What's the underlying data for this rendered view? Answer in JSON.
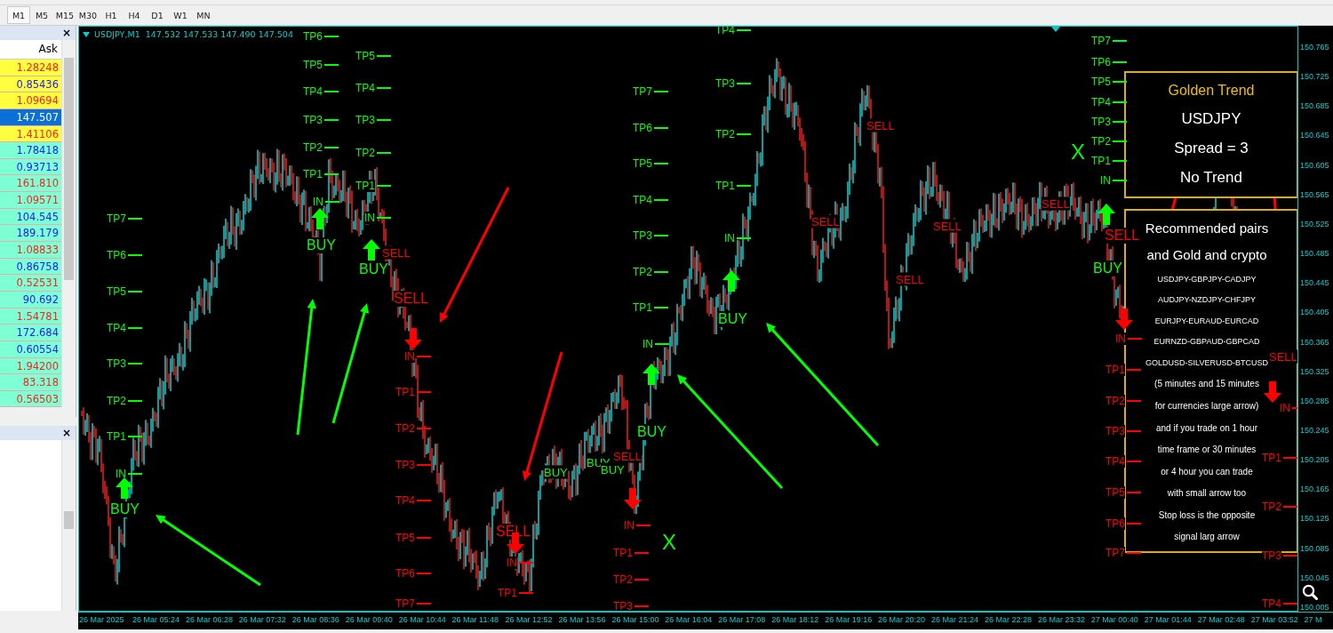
{
  "toolbar": {
    "timeframes": [
      {
        "label": "M1",
        "selected": true
      },
      {
        "label": "M5",
        "selected": false
      },
      {
        "label": "M15",
        "selected": false
      },
      {
        "label": "M30",
        "selected": false
      },
      {
        "label": "H1",
        "selected": false
      },
      {
        "label": "H4",
        "selected": false
      },
      {
        "label": "D1",
        "selected": false
      },
      {
        "label": "W1",
        "selected": false
      },
      {
        "label": "MN",
        "selected": false
      }
    ]
  },
  "market_watch": {
    "close": "×",
    "column": "Ask",
    "rows": [
      {
        "ask": "1.28248",
        "highlighted": true,
        "rising": false,
        "selected": false
      },
      {
        "ask": "0.85436",
        "highlighted": true,
        "rising": true,
        "selected": false
      },
      {
        "ask": "1.09694",
        "highlighted": true,
        "rising": false,
        "selected": false
      },
      {
        "ask": "147.507",
        "highlighted": false,
        "rising": true,
        "selected": true
      },
      {
        "ask": "1.41106",
        "highlighted": true,
        "rising": false,
        "selected": false
      },
      {
        "ask": "1.78418",
        "highlighted": false,
        "rising": true,
        "selected": false
      },
      {
        "ask": "0.93713",
        "highlighted": false,
        "rising": true,
        "selected": false
      },
      {
        "ask": "161.810",
        "highlighted": false,
        "rising": false,
        "selected": false
      },
      {
        "ask": "1.09571",
        "highlighted": false,
        "rising": false,
        "selected": false
      },
      {
        "ask": "104.545",
        "highlighted": false,
        "rising": true,
        "selected": false
      },
      {
        "ask": "189.179",
        "highlighted": false,
        "rising": true,
        "selected": false
      },
      {
        "ask": "1.08833",
        "highlighted": false,
        "rising": false,
        "selected": false
      },
      {
        "ask": "0.86758",
        "highlighted": false,
        "rising": true,
        "selected": false
      },
      {
        "ask": "0.52531",
        "highlighted": false,
        "rising": false,
        "selected": false
      },
      {
        "ask": "90.692",
        "highlighted": false,
        "rising": true,
        "selected": false
      },
      {
        "ask": "1.54781",
        "highlighted": false,
        "rising": false,
        "selected": false
      },
      {
        "ask": "172.684",
        "highlighted": false,
        "rising": true,
        "selected": false
      },
      {
        "ask": "0.60554",
        "highlighted": false,
        "rising": true,
        "selected": false
      },
      {
        "ask": "1.94200",
        "highlighted": false,
        "rising": false,
        "selected": false
      },
      {
        "ask": "83.318",
        "highlighted": false,
        "rising": false,
        "selected": false
      },
      {
        "ask": "0.56503",
        "highlighted": false,
        "rising": false,
        "selected": false
      }
    ]
  },
  "navigator": {
    "close": "×"
  },
  "chart": {
    "header": "USDJPY,M1  147.532 147.533 147.490 147.504",
    "price_axis": [
      "150.765",
      "150.725",
      "150.685",
      "150.645",
      "150.605",
      "150.565",
      "150.525",
      "150.485",
      "150.445",
      "150.405",
      "150.365",
      "150.325",
      "150.285",
      "150.245",
      "150.205",
      "150.165",
      "150.125",
      "150.085",
      "150.045",
      "150.005"
    ],
    "time_axis": [
      "26 Mar 2025",
      "26 Mar 05:24",
      "26 Mar 06:28",
      "26 Mar 07:32",
      "26 Mar 08:36",
      "26 Mar 09:40",
      "26 Mar 10:44",
      "26 Mar 11:48",
      "26 Mar 12:52",
      "26 Mar 13:56",
      "26 Mar 15:00",
      "26 Mar 16:04",
      "26 Mar 17:08",
      "26 Mar 18:12",
      "26 Mar 19:16",
      "26 Mar 20:20",
      "26 Mar 21:24",
      "26 Mar 22:28",
      "26 Mar 23:32",
      "27 Mar 00:40",
      "27 Mar 01:44",
      "27 Mar 02:48",
      "27 Mar 03:52",
      "27 M"
    ],
    "markers": [
      {
        "kind": "level",
        "buy": true,
        "text": "TP7"
      },
      {
        "kind": "level",
        "buy": true,
        "text": "TP6"
      },
      {
        "kind": "level",
        "buy": true,
        "text": "TP5"
      },
      {
        "kind": "level",
        "buy": true,
        "text": "TP4"
      },
      {
        "kind": "level",
        "buy": true,
        "text": "TP3"
      },
      {
        "kind": "level",
        "buy": true,
        "text": "TP2"
      },
      {
        "kind": "level",
        "buy": true,
        "text": "TP1"
      },
      {
        "kind": "level",
        "buy": true,
        "text": "IN"
      },
      {
        "kind": "signal",
        "buy": true,
        "text": "BUY"
      },
      {
        "kind": "arrow",
        "buy": true
      },
      {
        "kind": "level",
        "buy": true,
        "text": "TP6"
      },
      {
        "kind": "level",
        "buy": true,
        "text": "TP5"
      },
      {
        "kind": "level",
        "buy": true,
        "text": "TP4"
      },
      {
        "kind": "level",
        "buy": true,
        "text": "TP3"
      },
      {
        "kind": "level",
        "buy": true,
        "text": "TP2"
      },
      {
        "kind": "level",
        "buy": true,
        "text": "TP1"
      },
      {
        "kind": "level",
        "buy": true,
        "text": "IN"
      },
      {
        "kind": "signal",
        "buy": true,
        "text": "BUY"
      },
      {
        "kind": "arrow",
        "buy": true
      },
      {
        "kind": "level",
        "buy": true,
        "text": "TP5"
      },
      {
        "kind": "level",
        "buy": true,
        "text": "TP4"
      },
      {
        "kind": "level",
        "buy": true,
        "text": "TP3"
      },
      {
        "kind": "level",
        "buy": true,
        "text": "TP2"
      },
      {
        "kind": "level",
        "buy": true,
        "text": "TP1"
      },
      {
        "kind": "level",
        "buy": true,
        "text": "IN"
      },
      {
        "kind": "signal",
        "buy": true,
        "text": "BUY"
      },
      {
        "kind": "arrow",
        "buy": true
      },
      {
        "kind": "small",
        "buy": false,
        "text": "SELL"
      },
      {
        "kind": "signal",
        "buy": false,
        "text": "SELL"
      },
      {
        "kind": "arrow",
        "buy": false
      },
      {
        "kind": "level",
        "buy": false,
        "text": "IN"
      },
      {
        "kind": "level",
        "buy": false,
        "text": "TP1"
      },
      {
        "kind": "level",
        "buy": false,
        "text": "TP2"
      },
      {
        "kind": "level",
        "buy": false,
        "text": "TP3"
      },
      {
        "kind": "level",
        "buy": false,
        "text": "TP4"
      },
      {
        "kind": "level",
        "buy": false,
        "text": "TP5"
      },
      {
        "kind": "level",
        "buy": false,
        "text": "TP6"
      },
      {
        "kind": "level",
        "buy": false,
        "text": "TP7"
      },
      {
        "kind": "signal",
        "buy": false,
        "text": "SELL"
      },
      {
        "kind": "arrow",
        "buy": false
      },
      {
        "kind": "level",
        "buy": false,
        "text": "IN"
      },
      {
        "kind": "level",
        "buy": false,
        "text": "TP1"
      },
      {
        "kind": "small",
        "buy": true,
        "text": "BUY"
      },
      {
        "kind": "small",
        "buy": true,
        "text": "BUY"
      },
      {
        "kind": "small",
        "buy": true,
        "text": "BUY"
      },
      {
        "kind": "small",
        "buy": false,
        "text": "SELL"
      },
      {
        "kind": "level",
        "buy": true,
        "text": "TP7"
      },
      {
        "kind": "level",
        "buy": true,
        "text": "TP6"
      },
      {
        "kind": "level",
        "buy": true,
        "text": "TP5"
      },
      {
        "kind": "level",
        "buy": true,
        "text": "TP4"
      },
      {
        "kind": "level",
        "buy": true,
        "text": "TP3"
      },
      {
        "kind": "level",
        "buy": true,
        "text": "TP2"
      },
      {
        "kind": "level",
        "buy": true,
        "text": "TP1"
      },
      {
        "kind": "level",
        "buy": true,
        "text": "IN"
      },
      {
        "kind": "signal",
        "buy": true,
        "text": "BUY"
      },
      {
        "kind": "arrow",
        "buy": true
      },
      {
        "kind": "arrow",
        "buy": false
      },
      {
        "kind": "level",
        "buy": false,
        "text": "IN"
      },
      {
        "kind": "level",
        "buy": false,
        "text": "TP1"
      },
      {
        "kind": "level",
        "buy": false,
        "text": "TP2"
      },
      {
        "kind": "level",
        "buy": false,
        "text": "TP3"
      },
      {
        "kind": "cross",
        "buy": true,
        "text": "X"
      },
      {
        "kind": "level",
        "buy": true,
        "text": "TP4"
      },
      {
        "kind": "level",
        "buy": true,
        "text": "TP3"
      },
      {
        "kind": "level",
        "buy": true,
        "text": "TP2"
      },
      {
        "kind": "level",
        "buy": true,
        "text": "TP1"
      },
      {
        "kind": "level",
        "buy": true,
        "text": "IN"
      },
      {
        "kind": "signal",
        "buy": true,
        "text": "BUY"
      },
      {
        "kind": "arrow",
        "buy": true
      },
      {
        "kind": "small",
        "buy": false,
        "text": "SELL"
      },
      {
        "kind": "small",
        "buy": false,
        "text": "SELL"
      },
      {
        "kind": "small",
        "buy": false,
        "text": "SELL"
      },
      {
        "kind": "small",
        "buy": false,
        "text": "SELL"
      },
      {
        "kind": "small",
        "buy": false,
        "text": "SELL"
      },
      {
        "kind": "level",
        "buy": true,
        "text": "TP7"
      },
      {
        "kind": "level",
        "buy": true,
        "text": "TP6"
      },
      {
        "kind": "level",
        "buy": true,
        "text": "TP5"
      },
      {
        "kind": "level",
        "buy": true,
        "text": "TP4"
      },
      {
        "kind": "level",
        "buy": true,
        "text": "TP3"
      },
      {
        "kind": "level",
        "buy": true,
        "text": "TP2"
      },
      {
        "kind": "level",
        "buy": true,
        "text": "TP1"
      },
      {
        "kind": "level",
        "buy": true,
        "text": "IN"
      },
      {
        "kind": "signal",
        "buy": true,
        "text": "BUY"
      },
      {
        "kind": "arrow",
        "buy": true
      },
      {
        "kind": "cross",
        "buy": true,
        "text": "X"
      },
      {
        "kind": "signal",
        "buy": false,
        "text": "SELL"
      },
      {
        "kind": "arrow",
        "buy": false
      },
      {
        "kind": "level",
        "buy": false,
        "text": "IN"
      },
      {
        "kind": "level",
        "buy": false,
        "text": "TP1"
      },
      {
        "kind": "level",
        "buy": false,
        "text": "TP2"
      },
      {
        "kind": "level",
        "buy": false,
        "text": "TP3"
      },
      {
        "kind": "level",
        "buy": false,
        "text": "TP4"
      },
      {
        "kind": "level",
        "buy": false,
        "text": "TP5"
      },
      {
        "kind": "level",
        "buy": false,
        "text": "TP6"
      },
      {
        "kind": "level",
        "buy": false,
        "text": "TP7"
      },
      {
        "kind": "small",
        "buy": false,
        "text": "SELL"
      },
      {
        "kind": "arrow",
        "buy": false
      },
      {
        "kind": "level",
        "buy": false,
        "text": "IN"
      },
      {
        "kind": "level",
        "buy": false,
        "text": "TP1"
      },
      {
        "kind": "level",
        "buy": false,
        "text": "TP2"
      },
      {
        "kind": "level",
        "buy": false,
        "text": "TP3"
      },
      {
        "kind": "level",
        "buy": false,
        "text": "TP4"
      }
    ],
    "annotations": [
      {
        "buy": true
      },
      {
        "buy": true
      },
      {
        "buy": true
      },
      {
        "buy": true
      },
      {
        "buy": true
      },
      {
        "buy": false
      },
      {
        "buy": false
      },
      {
        "buy": false
      },
      {
        "buy": false
      }
    ],
    "info_panel": {
      "title": "Golden Trend",
      "symbol": "USDJPY",
      "spread": "Spread = 3",
      "trend": "No Trend"
    },
    "notes_panel": {
      "heading": [
        "Recommended pairs",
        "and Gold and crypto"
      ],
      "pairs": [
        "USDJPY-GBPJPY-CADJPY",
        "AUDJPY-NZDJPY-CHFJPY",
        "EURJPY-EURAUD-EURCAD",
        "EURNZD-GBPAUD-GBPCAD",
        "GOLDUSD-SILVERUSD-BTCUSD"
      ],
      "advice": [
        "(5 minutes and 15 minutes",
        "for currencies large arrow)",
        "and if you trade on 1 hour",
        "time frame or 30 minutes",
        "or 4 hour you can trade",
        "with small arrow too"
      ],
      "stop_loss": [
        "Stop loss is the opposite",
        "signal larg arrow"
      ]
    }
  }
}
